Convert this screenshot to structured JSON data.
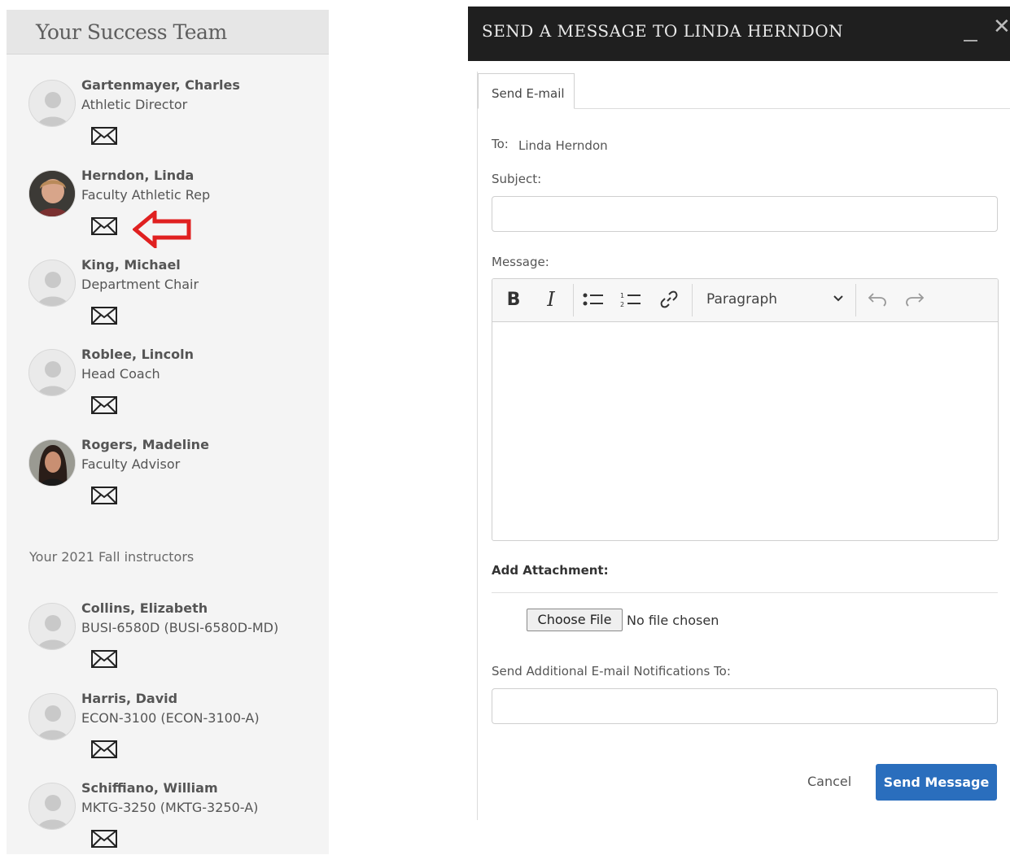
{
  "success_team": {
    "title": "Your Success Team",
    "members": [
      {
        "name": "Gartenmayer, Charles",
        "role": "Athletic Director",
        "avatar": "default-person-icon"
      },
      {
        "name": "Herndon, Linda",
        "role": "Faculty Athletic Rep",
        "avatar": "photo-linda-herndon"
      },
      {
        "name": "King, Michael",
        "role": "Department Chair",
        "avatar": "default-person-icon"
      },
      {
        "name": "Roblee, Lincoln",
        "role": "Head Coach",
        "avatar": "default-person-icon"
      },
      {
        "name": "Rogers, Madeline",
        "role": "Faculty Advisor",
        "avatar": "photo-madeline-rogers"
      }
    ],
    "instructors_label": "Your 2021 Fall instructors",
    "instructors": [
      {
        "name": "Collins, Elizabeth",
        "course": "BUSI-6580D (BUSI-6580D-MD)",
        "avatar": "default-person-icon"
      },
      {
        "name": "Harris, David",
        "course": "ECON-3100 (ECON-3100-A)",
        "avatar": "default-person-icon"
      },
      {
        "name": "Schiffiano, William",
        "course": "MKTG-3250 (MKTG-3250-A)",
        "avatar": "default-person-icon"
      }
    ],
    "mail_icon": "envelope-icon",
    "highlight_arrow_color": "#e02020"
  },
  "dialog": {
    "title": "SEND A MESSAGE TO LINDA HERNDON",
    "minimize_symbol": "_",
    "close_symbol": "✕",
    "tab_label": "Send E-mail",
    "to_label": "To:",
    "to_value": "Linda Herndon",
    "subject_label": "Subject:",
    "subject_value": "",
    "message_label": "Message:",
    "toolbar": {
      "bold": "B",
      "italic": "I",
      "bulleted_list_icon": "bulleted-list-icon",
      "numbered_list_icon": "numbered-list-icon",
      "link_icon": "link-icon",
      "format_value": "Paragraph",
      "undo_icon": "undo-icon",
      "redo_icon": "redo-icon"
    },
    "message_value": "",
    "attachment_label": "Add Attachment:",
    "choose_file_label": "Choose File",
    "no_file_text": "No file chosen",
    "notify_label": "Send Additional E-mail Notifications To:",
    "notify_value": "",
    "cancel_label": "Cancel",
    "send_label": "Send Message",
    "accent_color": "#2a6ebd",
    "header_color": "#1f1f1f"
  }
}
